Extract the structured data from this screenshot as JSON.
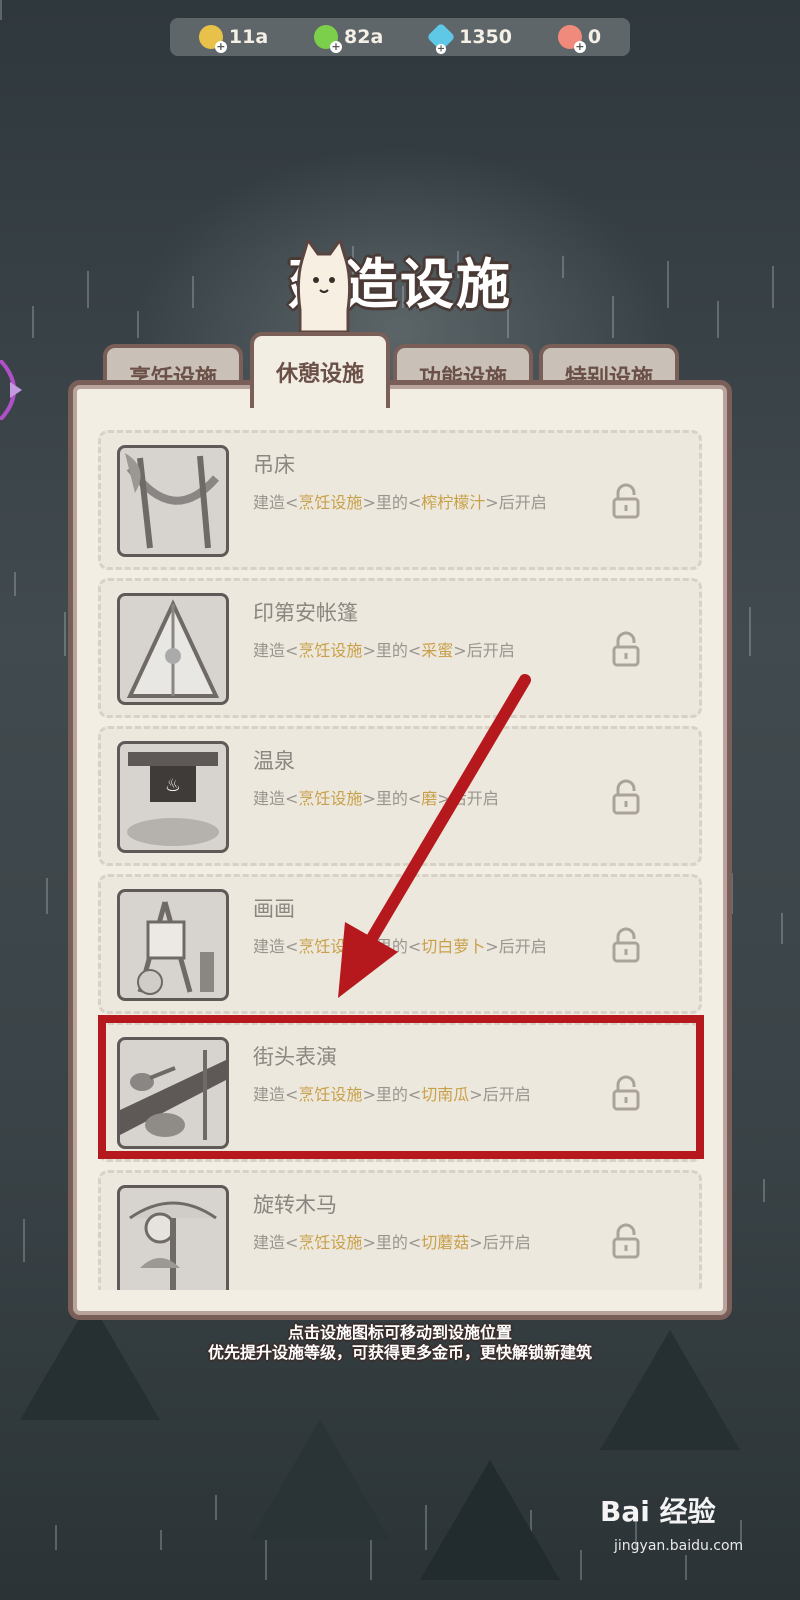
{
  "resources": [
    {
      "icon": "coin-icon",
      "value": "11a",
      "color": "#e8c14a"
    },
    {
      "icon": "lightning-icon",
      "value": "82a",
      "color": "#7ccf4a"
    },
    {
      "icon": "gem-icon",
      "value": "1350",
      "color": "#5ec8e6"
    },
    {
      "icon": "shell-icon",
      "value": "0",
      "color": "#f08a7c"
    }
  ],
  "title": "建造设施",
  "tabs": [
    "烹饪设施",
    "休憩设施",
    "功能设施",
    "特别设施"
  ],
  "active_tab": 1,
  "items": [
    {
      "name": "吊床",
      "pre": "建造<",
      "cat": "烹饪设施",
      "mid": ">里的<",
      "req": "榨柠檬汁",
      "post": ">后开启"
    },
    {
      "name": "印第安帐篷",
      "pre": "建造<",
      "cat": "烹饪设施",
      "mid": ">里的<",
      "req": "采蜜",
      "post": ">后开启"
    },
    {
      "name": "温泉",
      "pre": "建造<",
      "cat": "烹饪设施",
      "mid": ">里的<",
      "req": "磨",
      "post": ">后开启"
    },
    {
      "name": "画画",
      "pre": "建造<",
      "cat": "烹饪设施",
      "mid": ">里的<",
      "req": "切白萝卜",
      "post": ">后开启"
    },
    {
      "name": "街头表演",
      "pre": "建造<",
      "cat": "烹饪设施",
      "mid": ">里的<",
      "req": "切南瓜",
      "post": ">后开启"
    },
    {
      "name": "旋转木马",
      "pre": "建造<",
      "cat": "烹饪设施",
      "mid": ">里的<",
      "req": "切蘑菇",
      "post": ">后开启"
    }
  ],
  "hint_line1": "点击设施图标可移动到设施位置",
  "hint_line2": "优先提升设施等级，可获得更多金币，更快解锁新建筑",
  "watermark": "Bai 经验",
  "watermark_url": "jingyan.baidu.com",
  "colors": {
    "frame": "#7a5e58",
    "panel": "#f3eee3",
    "highlight": "#c9a04a",
    "annotation_red": "#b6191d"
  }
}
